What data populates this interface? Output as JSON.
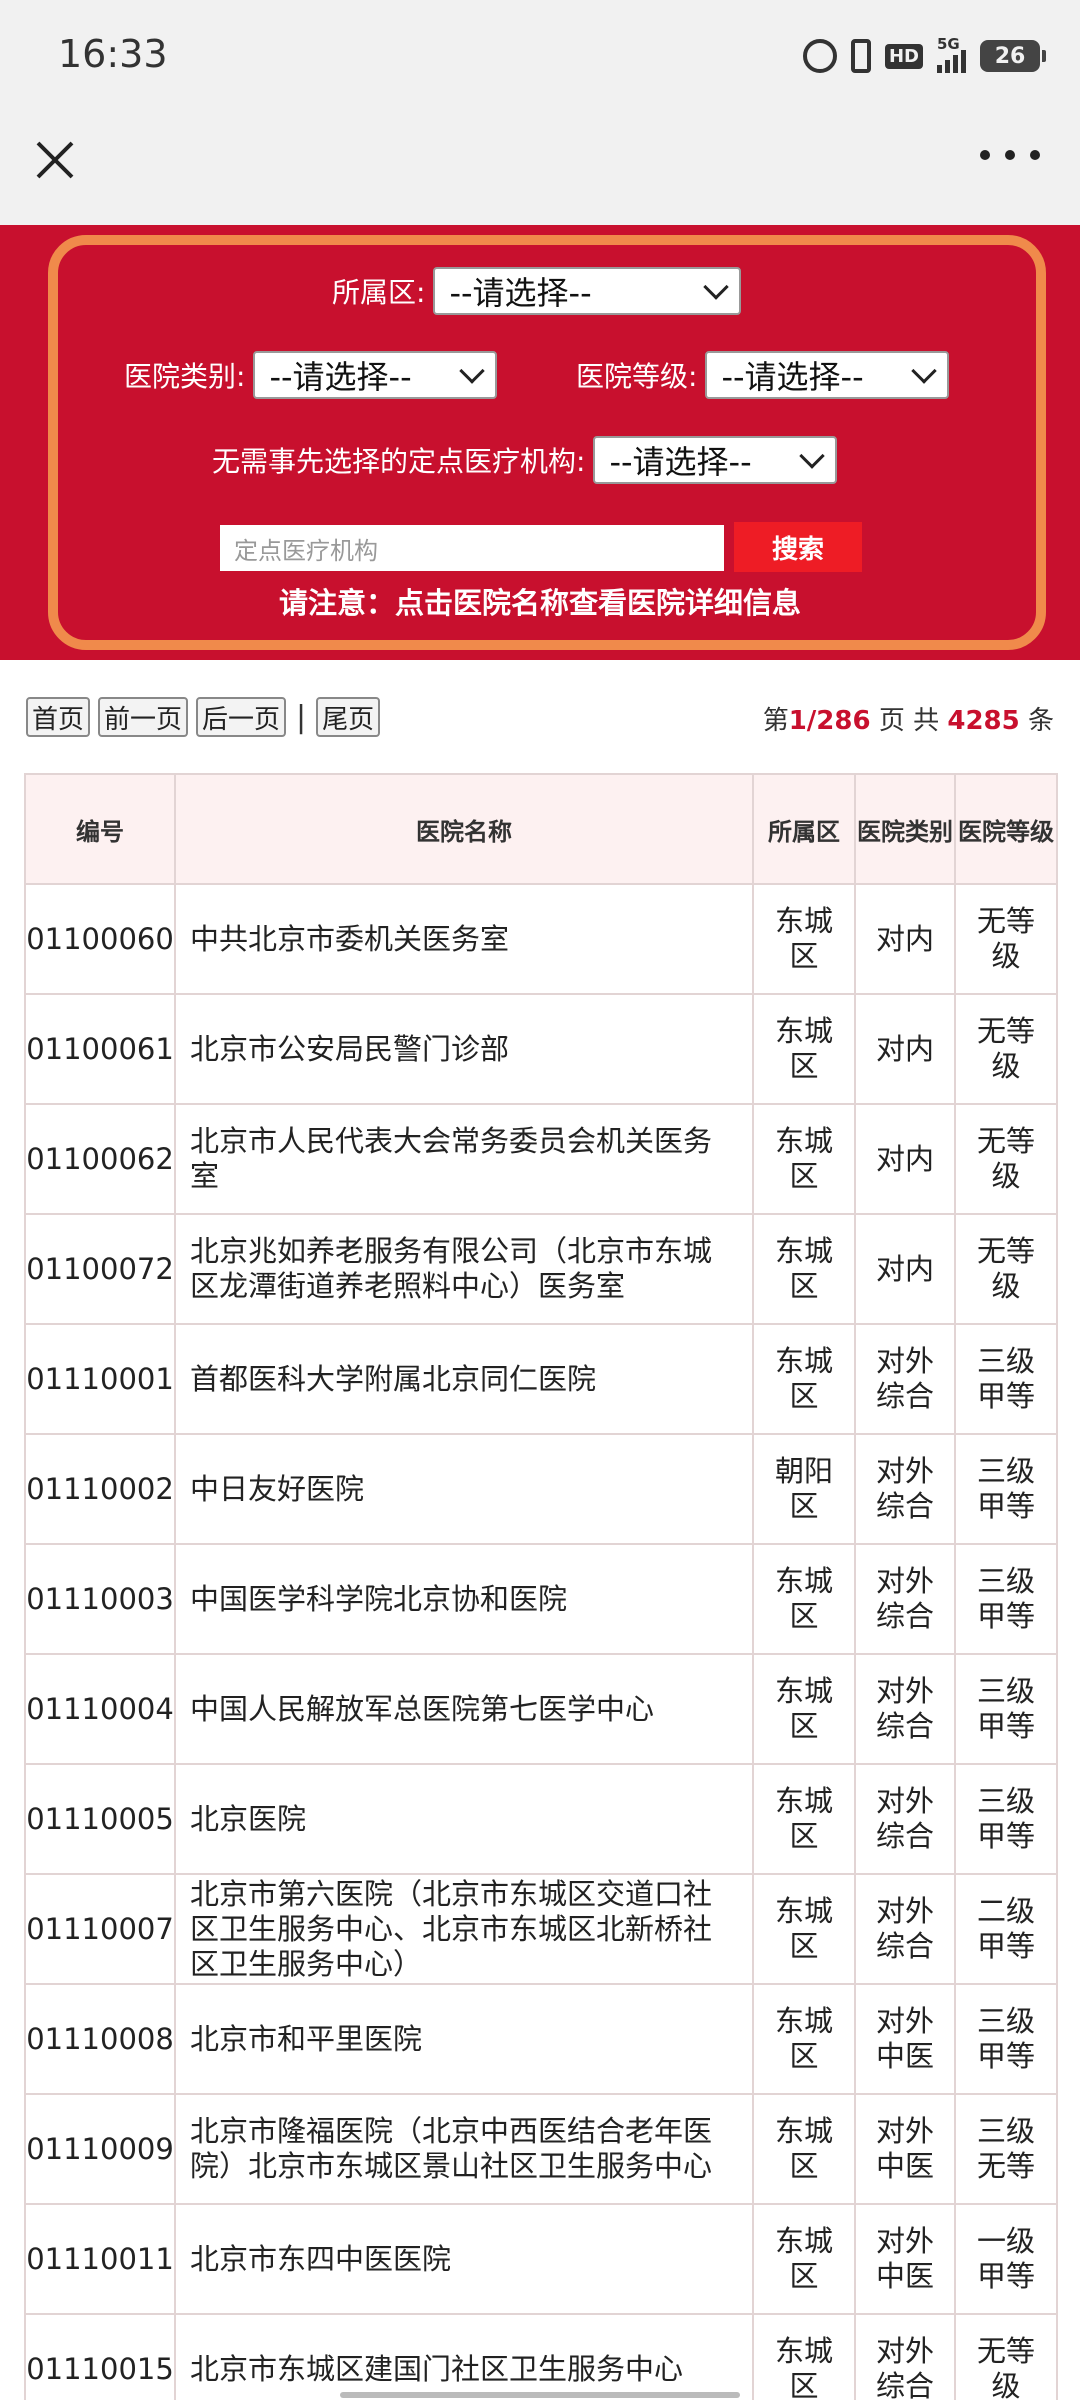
{
  "status": {
    "time": "16:33",
    "icons": [
      "alarm-icon",
      "vibrate-icon",
      "hd-icon",
      "signal-5g-icon",
      "battery-icon"
    ],
    "hd_label": "HD",
    "net_label": "5G",
    "battery": "26"
  },
  "nav": {
    "close_icon": "close-icon",
    "more_icon": "more-icon"
  },
  "filters": {
    "district_label": "所属区:",
    "district_value": "--请选择--",
    "category_label": "医院类别:",
    "category_value": "--请选择--",
    "level_label": "医院等级:",
    "level_value": "--请选择--",
    "designated_label": "无需事先选择的定点医疗机构:",
    "designated_value": "--请选择--",
    "search_placeholder": "定点医疗机构",
    "search_button": "搜索",
    "notice": "请注意：点击医院名称查看医院详细信息"
  },
  "pager": {
    "first": "首页",
    "prev": "前一页",
    "next": "后一页",
    "divider": "|",
    "last": "尾页",
    "page_prefix": "第",
    "page_current": "1/286",
    "page_suffix": " 页  共 ",
    "total": "4285",
    "total_suffix": " 条"
  },
  "table": {
    "headers": [
      "编号",
      "医院名称",
      "所属区",
      "医院类别",
      "医院等级"
    ],
    "rows": [
      {
        "id": "01100060",
        "name": "中共北京市委机关医务室",
        "district": "东城区",
        "category": "对内",
        "level": "无等级"
      },
      {
        "id": "01100061",
        "name": "北京市公安局民警门诊部",
        "district": "东城区",
        "category": "对内",
        "level": "无等级"
      },
      {
        "id": "01100062",
        "name": "北京市人民代表大会常务委员会机关医务室",
        "district": "东城区",
        "category": "对内",
        "level": "无等级"
      },
      {
        "id": "01100072",
        "name": "北京兆如养老服务有限公司（北京市东城区龙潭街道养老照料中心）医务室",
        "district": "东城区",
        "category": "对内",
        "level": "无等级"
      },
      {
        "id": "01110001",
        "name": "首都医科大学附属北京同仁医院",
        "district": "东城区",
        "category": "对外综合",
        "level": "三级甲等"
      },
      {
        "id": "01110002",
        "name": "中日友好医院",
        "district": "朝阳区",
        "category": "对外综合",
        "level": "三级甲等"
      },
      {
        "id": "01110003",
        "name": "中国医学科学院北京协和医院",
        "district": "东城区",
        "category": "对外综合",
        "level": "三级甲等"
      },
      {
        "id": "01110004",
        "name": "中国人民解放军总医院第七医学中心",
        "district": "东城区",
        "category": "对外综合",
        "level": "三级甲等"
      },
      {
        "id": "01110005",
        "name": "北京医院",
        "district": "东城区",
        "category": "对外综合",
        "level": "三级甲等"
      },
      {
        "id": "01110007",
        "name": "北京市第六医院（北京市东城区交道口社区卫生服务中心、北京市东城区北新桥社区卫生服务中心）",
        "district": "东城区",
        "category": "对外综合",
        "level": "二级甲等"
      },
      {
        "id": "01110008",
        "name": "北京市和平里医院",
        "district": "东城区",
        "category": "对外中医",
        "level": "三级甲等"
      },
      {
        "id": "01110009",
        "name": "北京市隆福医院（北京中西医结合老年医院）北京市东城区景山社区卫生服务中心",
        "district": "东城区",
        "category": "对外中医",
        "level": "三级无等"
      },
      {
        "id": "01110011",
        "name": "北京市东四中医医院",
        "district": "东城区",
        "category": "对外中医",
        "level": "一级甲等"
      },
      {
        "id": "01110015",
        "name": "北京市东城区建国门社区卫生服务中心",
        "district": "东城区",
        "category": "对外综合",
        "level": "无等级"
      }
    ]
  }
}
